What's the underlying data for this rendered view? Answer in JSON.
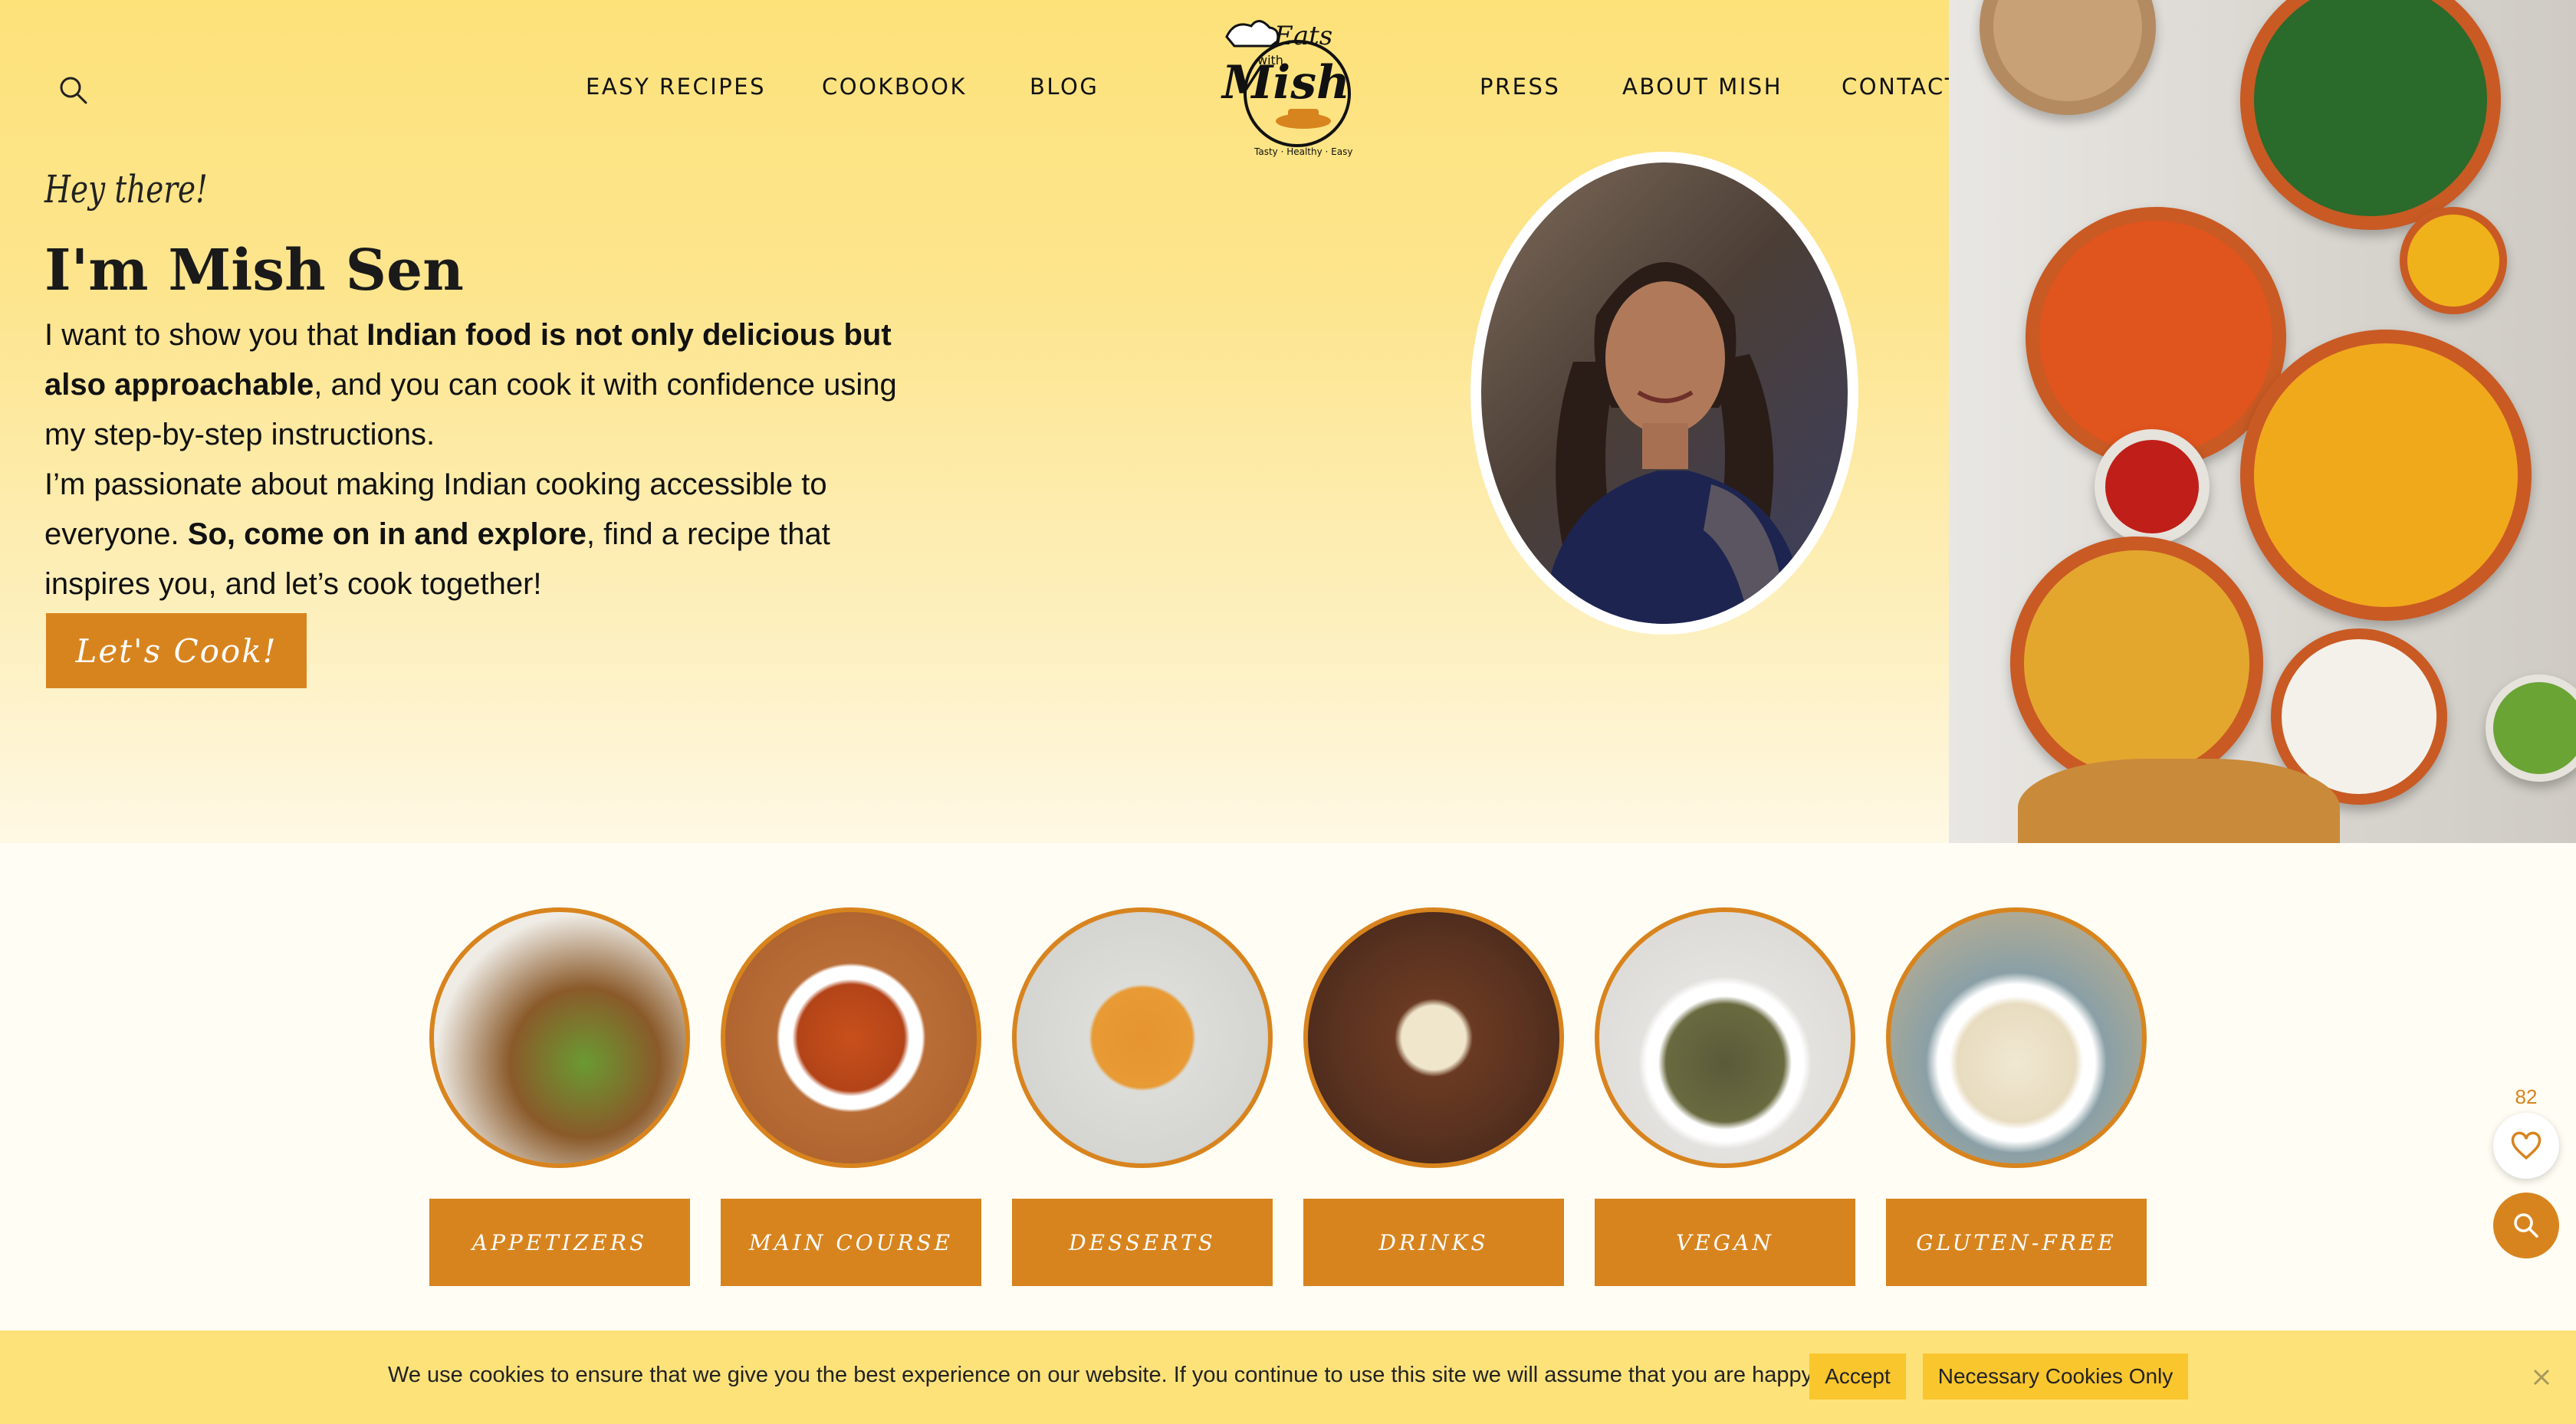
{
  "header": {
    "nav_left": [
      "EASY RECIPES",
      "COOKBOOK",
      "BLOG"
    ],
    "nav_right": [
      "PRESS",
      "ABOUT MISH",
      "CONTACT"
    ],
    "logo": {
      "line1": "Eats",
      "line2": "with",
      "line3": "Mish",
      "tagline": "Tasty · Healthy · Easy"
    },
    "search_icon": "search-icon"
  },
  "intro": {
    "greeting": "Hey there!",
    "name": "I'm Mish Sen",
    "p1_a": "I want to show you that ",
    "p1_b": "Indian food is not only delicious but also approachable",
    "p1_c": ", and you can cook it with confidence using my step-by-step instructions.",
    "p2_a": "I’m passionate about making Indian cooking accessible to everyone. ",
    "p2_b": "So, come on in and explore",
    "p2_c": ", find a recipe that inspires you, and let’s cook together!",
    "cta": "Let's Cook!"
  },
  "categories": [
    {
      "label": "APPETIZERS"
    },
    {
      "label": "MAIN COURSE"
    },
    {
      "label": "DESSERTS"
    },
    {
      "label": "DRINKS"
    },
    {
      "label": "VEGAN"
    },
    {
      "label": "GLUTEN-FREE"
    }
  ],
  "floating": {
    "favorites_count": "82",
    "heart_icon": "heart-icon",
    "search_icon": "search-icon"
  },
  "cookie": {
    "message": "We use cookies to ensure that we give you the best experience on our website. If you continue to use this site we will assume that you are happy with it.",
    "accept": "Accept",
    "necessary": "Necessary Cookies Only",
    "close_icon": "close-icon"
  },
  "colors": {
    "accent": "#d8841e",
    "hero_yellow": "#fde27a",
    "cookie_button": "#fac62d"
  }
}
